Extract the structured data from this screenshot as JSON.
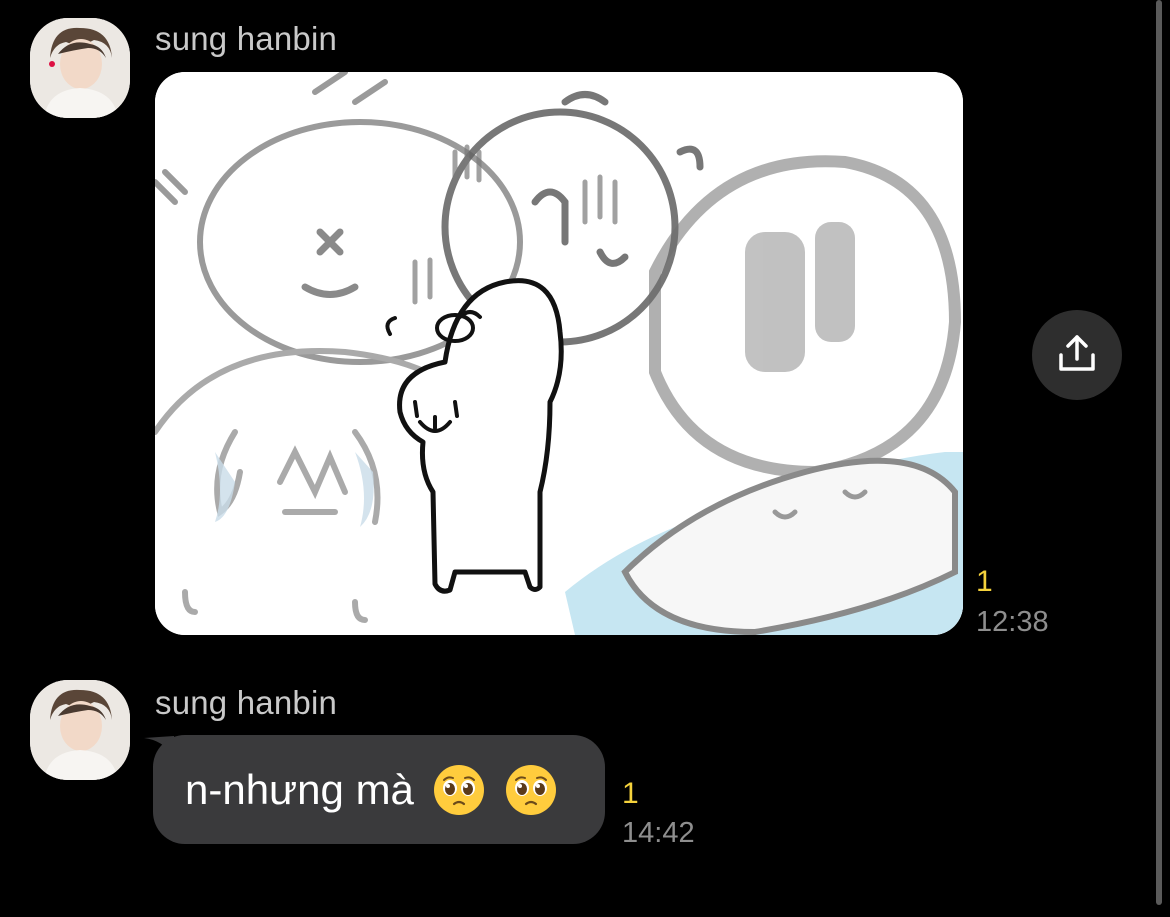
{
  "messages": [
    {
      "sender": "sung hanbin",
      "type": "image",
      "unread": "1",
      "time": "12:38"
    },
    {
      "sender": "sung hanbin",
      "type": "text",
      "text": "n-nhưng mà",
      "emoji": [
        "pleading-face-emoji",
        "pleading-face-emoji"
      ],
      "unread": "1",
      "time": "14:42"
    }
  ],
  "share_button": {
    "icon": "share-upload-icon"
  },
  "colors": {
    "background": "#000000",
    "bubble": "#3a3a3c",
    "unread": "#f5d23c",
    "time": "#8e8e8e",
    "sender": "#c9c9c9"
  }
}
